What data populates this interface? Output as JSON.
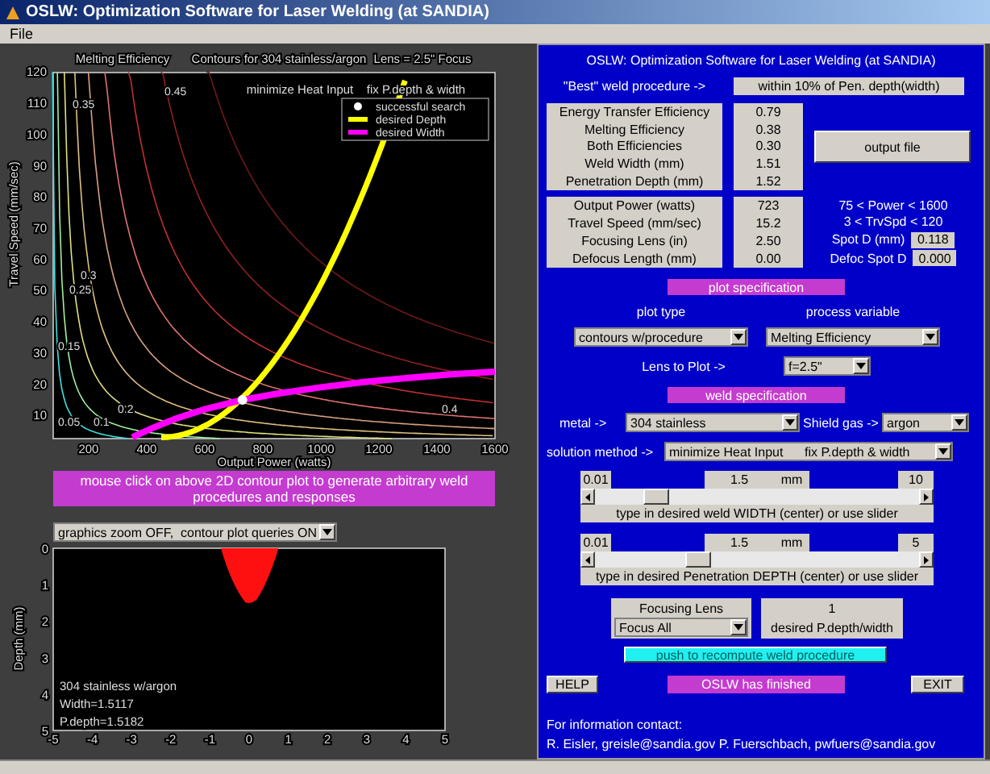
{
  "window": {
    "title": "OSLW: Optimization Software for Laser Welding (at SANDIA)"
  },
  "menu": [
    "File"
  ],
  "contour_plot": {
    "titles": [
      "Melting Efficiency",
      "Contours for 304 stainless/argon",
      "Lens = 2.5\" Focus"
    ],
    "notes": [
      "minimize Heat Input",
      "fix P.depth & width"
    ],
    "legend": [
      {
        "label": "successful search",
        "color": "#ffffff",
        "kind": "dot"
      },
      {
        "label": "desired Depth",
        "color": "#ffff00",
        "kind": "line"
      },
      {
        "label": "desired Width",
        "color": "#ff00ff",
        "kind": "line"
      }
    ],
    "contour_labels": [
      "0.35",
      "0.45",
      "0.3",
      "0.25",
      "0.15",
      "0.2",
      "0.05",
      "0.1",
      "0.4"
    ],
    "xticks": [
      "200",
      "400",
      "600",
      "800",
      "1000",
      "1200",
      "1400",
      "1600"
    ],
    "yticks": [
      "120",
      "110",
      "100",
      "90",
      "80",
      "70",
      "60",
      "50",
      "40",
      "30",
      "20",
      "10"
    ],
    "xlabel": "Output Power  (watts)",
    "ylabel": "Travel Speed  (mm/sec)"
  },
  "hint_banner": "mouse click on above 2D contour plot to generate arbitrary weld procedures and responses",
  "graphics_dropdown": "graphics zoom OFF,  contour plot queries ON",
  "profile_plot": {
    "xticks": [
      "-5",
      "-4",
      "-3",
      "-2",
      "-1",
      "0",
      "1",
      "2",
      "3",
      "4",
      "5"
    ],
    "yticks": [
      "0",
      "1",
      "2",
      "3",
      "4",
      "5"
    ],
    "ylabel": "Depth  (mm)",
    "notes": [
      "304 stainless w/argon",
      "Width=1.5117",
      "P.depth=1.5182"
    ]
  },
  "panel": {
    "title": "OSLW: Optimization Software for Laser Welding (at SANDIA)",
    "best_label": "\"Best\" weld procedure ->",
    "best_value": "within 10% of Pen. depth(width)",
    "responses": [
      {
        "label": "Energy Transfer Efficiency",
        "value": "0.79"
      },
      {
        "label": "Melting Efficiency",
        "value": "0.38"
      },
      {
        "label": "Both Efficiencies",
        "value": "0.30"
      },
      {
        "label": "Weld Width (mm)",
        "value": "1.51"
      },
      {
        "label": "Penetration Depth  (mm)",
        "value": "1.52"
      }
    ],
    "output_button": "output file",
    "inputs": [
      {
        "label": "Output Power (watts)",
        "value": "723"
      },
      {
        "label": "Travel Speed (mm/sec)",
        "value": "15.2"
      },
      {
        "label": "Focusing Lens (in)",
        "value": "2.50"
      },
      {
        "label": "Defocus Length (mm)",
        "value": "0.00"
      }
    ],
    "limits": [
      "75 < Power  < 1600",
      "3 < TrvSpd < 120"
    ],
    "spots": [
      {
        "label": "Spot D (mm)",
        "value": "0.118"
      },
      {
        "label": "Defoc Spot D",
        "value": "0.000"
      }
    ],
    "plot_spec": "plot specification",
    "plot_type_label": "plot type",
    "process_variable_label": "process variable",
    "plot_type": "contours w/procedure",
    "process_variable": "Melting Efficiency",
    "lens_label": "Lens to Plot ->",
    "lens": "f=2.5\"",
    "weld_spec": "weld specification",
    "metal_label": "metal ->",
    "metal": "304 stainless",
    "gas_label": "Shield gas ->",
    "gas": "argon",
    "method_label": "solution method ->",
    "method": "minimize Heat Input      fix P.depth & width",
    "sliders": [
      {
        "min": "0.01",
        "value": "1.5",
        "unit": "mm",
        "max": "10",
        "level": 0.16,
        "caption": "type in desired weld WIDTH (center) or use slider"
      },
      {
        "min": "0.01",
        "value": "1.5",
        "unit": "mm",
        "max": "5",
        "level": 0.3,
        "caption": "type in desired Penetration DEPTH (center) or use slider"
      }
    ],
    "lens_group": {
      "label": "Focusing Lens",
      "value": "Focus All"
    },
    "ratio": {
      "value": "1",
      "label": "desired P.depth/width"
    },
    "recompute_button": "push to recompute weld procedure",
    "help_button": "HELP",
    "status": "OSLW has finished",
    "exit_button": "EXIT",
    "contact": [
      "For information contact:",
      "R. Eisler, greisle@sandia.gov  P. Fuerschbach, pwfuers@sandia.gov"
    ]
  }
}
